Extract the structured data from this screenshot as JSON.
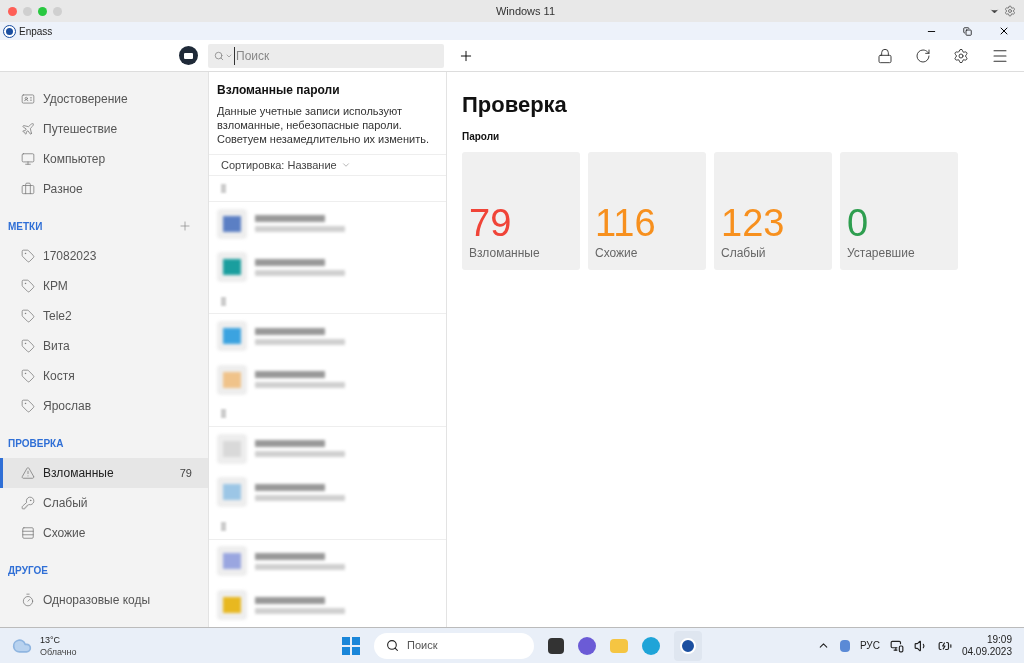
{
  "host_window": {
    "title": "Windows 11"
  },
  "app_window": {
    "title": "Enpass"
  },
  "search": {
    "placeholder": "Поиск"
  },
  "sidebar": {
    "groups": [
      {
        "items": [
          {
            "label": "Удостоверение",
            "selected": false
          },
          {
            "label": "Путешествие",
            "selected": false
          },
          {
            "label": "Компьютер",
            "selected": false
          },
          {
            "label": "Разное",
            "selected": false
          }
        ]
      },
      {
        "title": "МЕТКИ",
        "addable": true,
        "items": [
          {
            "label": "17082023",
            "selected": false
          },
          {
            "label": "КРМ",
            "selected": false
          },
          {
            "label": "Tele2",
            "selected": false
          },
          {
            "label": "Вита",
            "selected": false
          },
          {
            "label": "Костя",
            "selected": false
          },
          {
            "label": "Ярослав",
            "selected": false
          }
        ]
      },
      {
        "title": "ПРОВЕРКА",
        "addable": false,
        "items": [
          {
            "label": "Взломанные",
            "selected": true,
            "count": "79"
          },
          {
            "label": "Слабый",
            "selected": false
          },
          {
            "label": "Схожие",
            "selected": false
          }
        ]
      },
      {
        "title": "ДРУГОЕ",
        "addable": false,
        "items": [
          {
            "label": "Одноразовые коды",
            "selected": false
          }
        ]
      }
    ]
  },
  "list": {
    "title": "Взломанные пароли",
    "description": "Данные учетные записи используют взломанные, небезопасные пароли. Советуем незамедлительно их изменить.",
    "sort": "Сортировка: Название",
    "rows": [
      {
        "kind": "header"
      },
      {
        "kind": "entry",
        "color": "#5b7fc4"
      },
      {
        "kind": "entry",
        "color": "#1a9e9e"
      },
      {
        "kind": "header"
      },
      {
        "kind": "entry",
        "color": "#3ba3e0"
      },
      {
        "kind": "entry",
        "color": "#f0c38a"
      },
      {
        "kind": "header"
      },
      {
        "kind": "entry",
        "color": "#d9d9d9"
      },
      {
        "kind": "entry",
        "color": "#9cc6e6"
      },
      {
        "kind": "header"
      },
      {
        "kind": "entry",
        "color": "#9aa6e0"
      },
      {
        "kind": "entry",
        "color": "#e8b820"
      }
    ]
  },
  "main": {
    "title": "Проверка",
    "section": "Пароли",
    "cards": [
      {
        "value": "79",
        "label": "Взломанные",
        "color": "#f04438"
      },
      {
        "value": "116",
        "label": "Схожие",
        "color": "#f7901e"
      },
      {
        "value": "123",
        "label": "Слабый",
        "color": "#f7901e"
      },
      {
        "value": "0",
        "label": "Устаревшие",
        "color": "#2e9e4f"
      }
    ]
  },
  "taskbar": {
    "weather": {
      "temp": "13°C",
      "text": "Облачно"
    },
    "search": {
      "placeholder": "Поиск"
    },
    "language": "РУС",
    "time": "19:09",
    "date": "04.09.2023"
  }
}
